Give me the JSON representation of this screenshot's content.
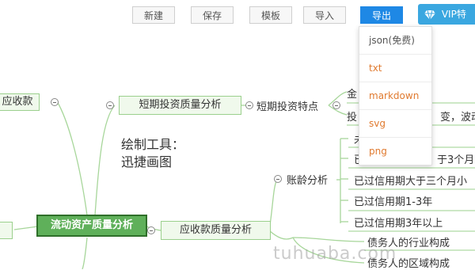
{
  "toolbar": {
    "new_label": "新建",
    "save_label": "保存",
    "template_label": "模板",
    "import_label": "导入",
    "export_label": "导出",
    "vip_label": "VIP特"
  },
  "export_menu": {
    "items": [
      "json(免费)",
      "txt",
      "markdown",
      "svg",
      "png"
    ]
  },
  "mindmap": {
    "left_top_node": "应收款",
    "root": "流动资产质量分析",
    "short_term": "短期投资质量分析",
    "short_term_feature": "短期投资特点",
    "feature_line1": "金",
    "feature_line2": "投",
    "feature_line2_tail": "变，波动",
    "receivable": "应收款质量分析",
    "aging": "账龄分析",
    "aging_items": [
      "未",
      "已",
      "已过信用期大于三个月小",
      "已过信用期1-3年",
      "已过信用期3年以上"
    ],
    "aging_item2_tail": "于3个月",
    "debtor_items": [
      "债务人的行业构成",
      "债务人的区域构成"
    ]
  },
  "canvas_note": {
    "line1": "绘制工具：",
    "line2": "迅捷画图"
  },
  "watermark": "tuhuaba.com",
  "colors": {
    "primary": "#1e88e5",
    "node_border": "#9bd08d",
    "root_fill": "#5fb05a",
    "menu_text": "#e07a2f"
  }
}
